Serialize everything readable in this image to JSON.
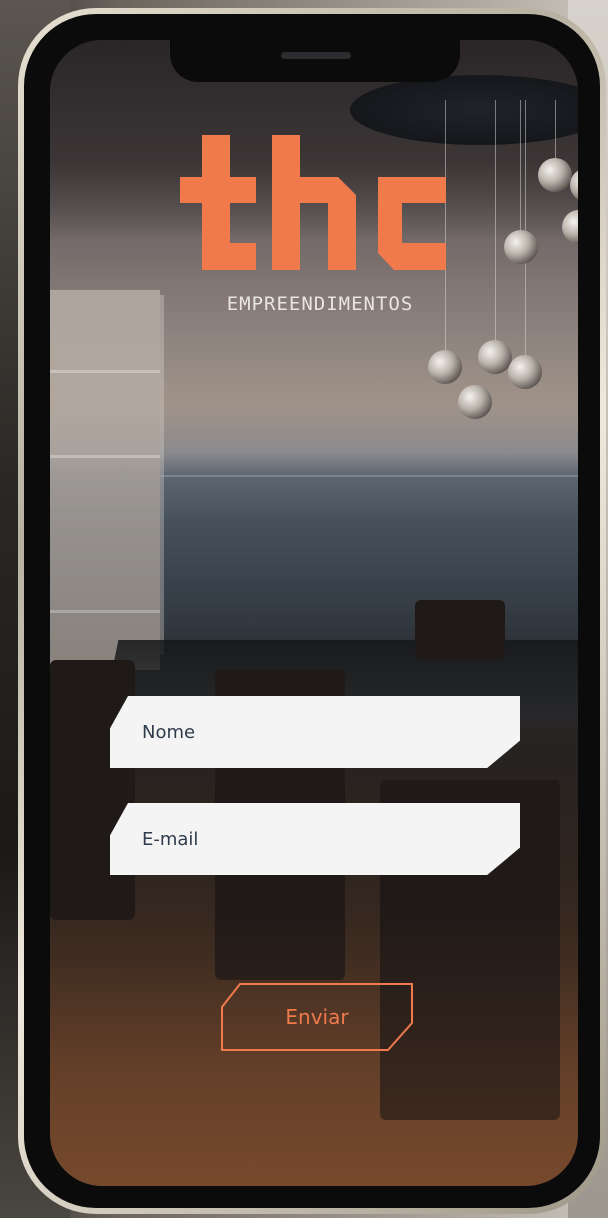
{
  "brand": {
    "wordmark": "thc",
    "subtitle": "EMPREENDIMENTOS",
    "accent_color": "#f07a4b"
  },
  "form": {
    "name_placeholder": "Nome",
    "email_placeholder": "E-mail",
    "submit_label": "Enviar"
  },
  "colors": {
    "field_bg": "#f4f4f4",
    "field_text": "#2f3b4a",
    "subtitle_text": "#e8e5e2"
  }
}
